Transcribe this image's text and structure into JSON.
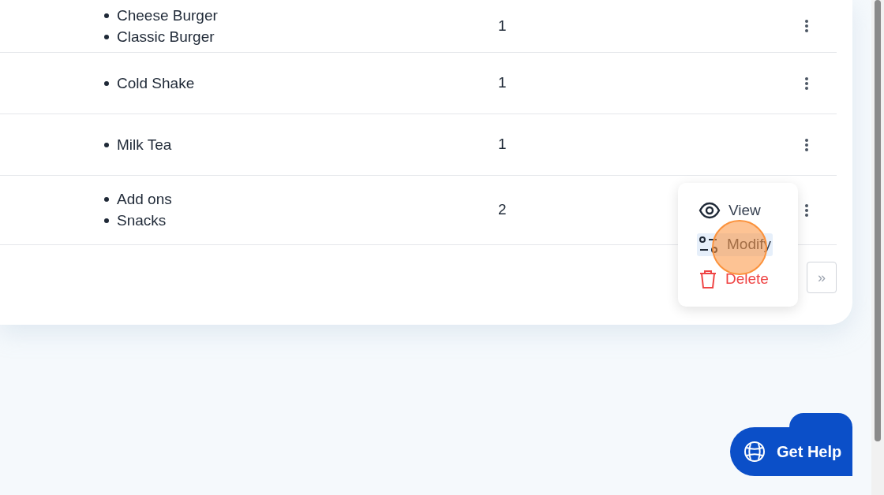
{
  "table": {
    "rows": [
      {
        "items": [
          "Cheese Burger",
          "Classic Burger"
        ],
        "quantity": "1"
      },
      {
        "items": [
          "Cold Shake"
        ],
        "quantity": "1"
      },
      {
        "items": [
          "Milk Tea"
        ],
        "quantity": "1"
      },
      {
        "items": [
          "Add ons",
          "Snacks"
        ],
        "quantity": "2"
      }
    ]
  },
  "pagination": {
    "last": "»"
  },
  "row_menu": {
    "items": [
      {
        "kind": "view",
        "label": "View",
        "selected": false
      },
      {
        "kind": "modify",
        "label": "Modify",
        "selected": true
      },
      {
        "kind": "delete",
        "label": "Delete",
        "selected": false
      }
    ]
  },
  "help_button": {
    "label": "Get Help"
  }
}
